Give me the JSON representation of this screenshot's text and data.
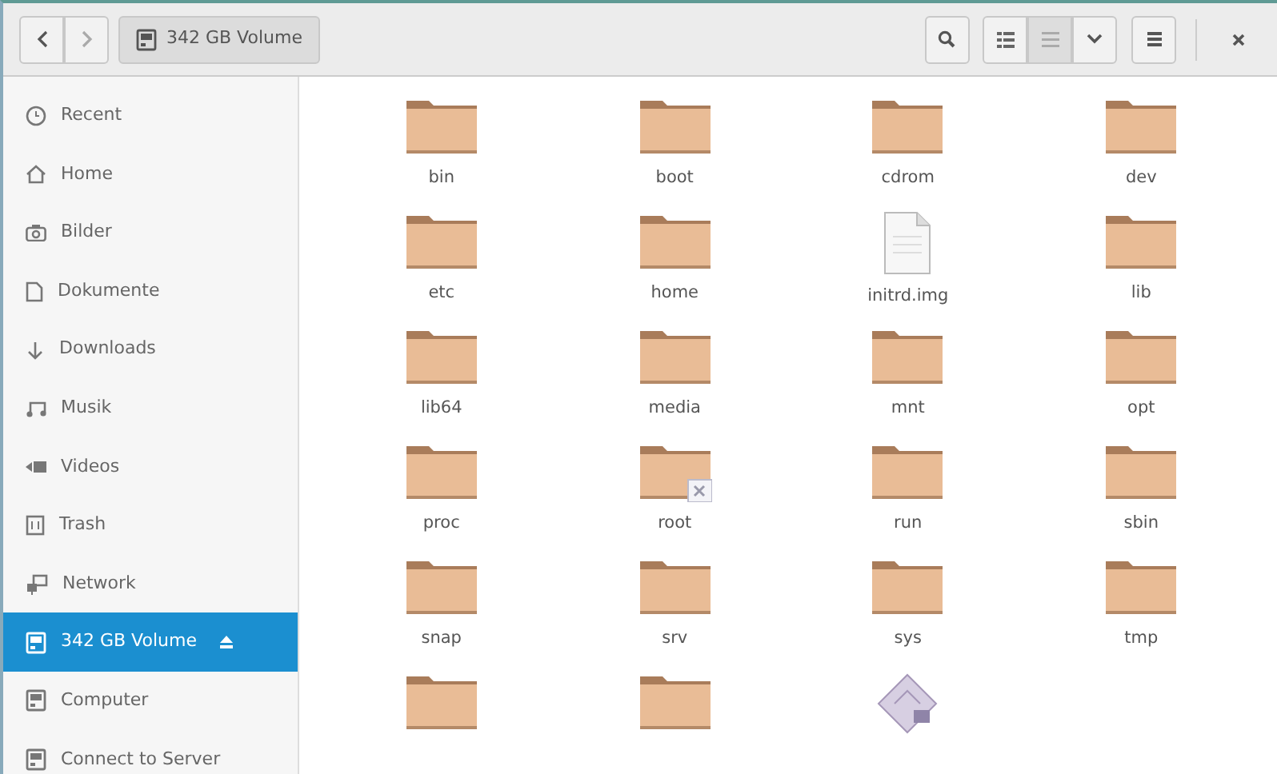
{
  "toolbar": {
    "location": "342 GB Volume"
  },
  "sidebar": {
    "items": [
      {
        "label": "Recent",
        "kind": "clock",
        "selected": false
      },
      {
        "label": "Home",
        "kind": "home",
        "selected": false
      },
      {
        "label": "Bilder",
        "kind": "camera",
        "selected": false
      },
      {
        "label": "Dokumente",
        "kind": "document",
        "selected": false
      },
      {
        "label": "Downloads",
        "kind": "download",
        "selected": false
      },
      {
        "label": "Musik",
        "kind": "music",
        "selected": false
      },
      {
        "label": "Videos",
        "kind": "video",
        "selected": false
      },
      {
        "label": "Trash",
        "kind": "trash",
        "selected": false
      },
      {
        "label": "Network",
        "kind": "network",
        "selected": false
      },
      {
        "label": "342 GB Volume",
        "kind": "drive",
        "selected": true,
        "eject": true
      },
      {
        "label": "Computer",
        "kind": "drive",
        "selected": false
      },
      {
        "label": "Connect to Server",
        "kind": "drive",
        "selected": false
      }
    ]
  },
  "files": [
    {
      "name": "bin",
      "kind": "folder"
    },
    {
      "name": "boot",
      "kind": "folder"
    },
    {
      "name": "cdrom",
      "kind": "folder"
    },
    {
      "name": "dev",
      "kind": "folder"
    },
    {
      "name": "etc",
      "kind": "folder"
    },
    {
      "name": "home",
      "kind": "folder"
    },
    {
      "name": "initrd.img",
      "kind": "file"
    },
    {
      "name": "lib",
      "kind": "folder"
    },
    {
      "name": "lib64",
      "kind": "folder"
    },
    {
      "name": "media",
      "kind": "folder"
    },
    {
      "name": "mnt",
      "kind": "folder"
    },
    {
      "name": "opt",
      "kind": "folder"
    },
    {
      "name": "proc",
      "kind": "folder"
    },
    {
      "name": "root",
      "kind": "locked-folder"
    },
    {
      "name": "run",
      "kind": "folder"
    },
    {
      "name": "sbin",
      "kind": "folder"
    },
    {
      "name": "snap",
      "kind": "folder"
    },
    {
      "name": "srv",
      "kind": "folder"
    },
    {
      "name": "sys",
      "kind": "folder"
    },
    {
      "name": "tmp",
      "kind": "folder"
    },
    {
      "kind": "folder"
    },
    {
      "kind": "folder"
    },
    {
      "kind": "package"
    }
  ]
}
